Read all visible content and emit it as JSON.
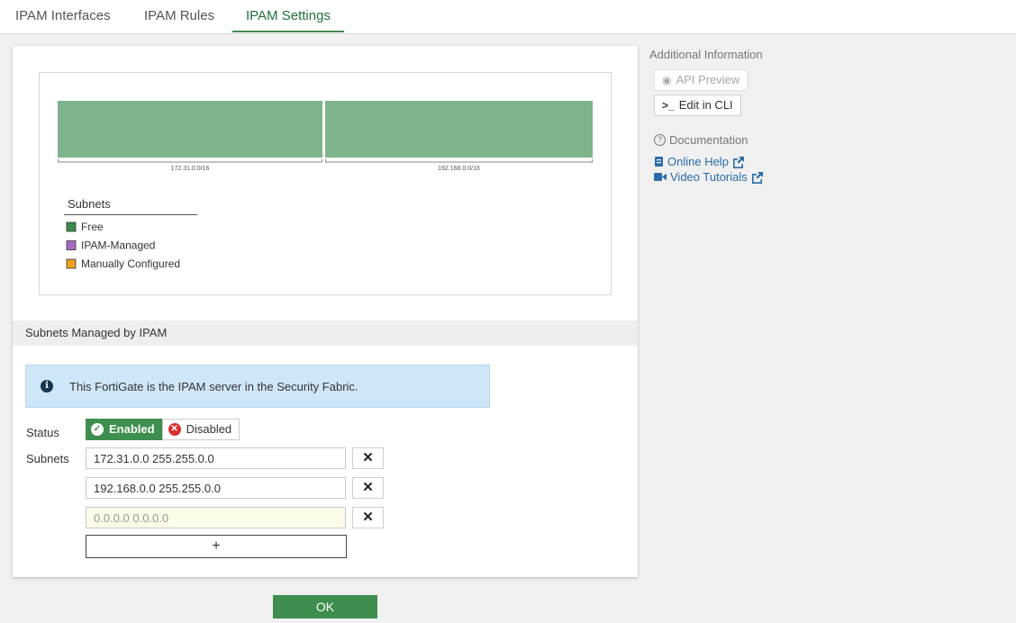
{
  "tabs": [
    {
      "label": "IPAM Interfaces"
    },
    {
      "label": "IPAM Rules"
    },
    {
      "label": "IPAM Settings"
    }
  ],
  "chart_data": {
    "type": "bar",
    "categories": [
      "172.31.0.0/16",
      "192.168.0.0/16"
    ],
    "series": [
      {
        "name": "Free",
        "values": [
          1,
          1
        ]
      },
      {
        "name": "IPAM-Managed",
        "values": [
          0,
          0
        ]
      },
      {
        "name": "Manually Configured",
        "values": [
          0,
          0
        ]
      }
    ],
    "legend_title": "Subnets",
    "legend_position": "bottom-left",
    "colors": {
      "Free": "#7fb38b",
      "IPAM-Managed": "#a46cc2",
      "Manually Configured": "#f0a020"
    },
    "legend_swatch_colors": {
      "Free": "#3d8a4f",
      "IPAM-Managed": "#a46cc2",
      "Manually Configured": "#f0a020"
    }
  },
  "section": {
    "title": "Subnets Managed by IPAM"
  },
  "info_message": "This FortiGate is the IPAM server in the Security Fabric.",
  "form": {
    "status_label": "Status",
    "enabled_label": "Enabled",
    "disabled_label": "Disabled",
    "subnets_label": "Subnets",
    "subnets": [
      "172.31.0.0 255.255.0.0",
      "192.168.0.0 255.255.0.0"
    ],
    "placeholder": "0.0.0.0 0.0.0.0",
    "add_label": "+",
    "remove_label": "✕"
  },
  "ok_label": "OK",
  "sidebar": {
    "title": "Additional Information",
    "api_preview": "API Preview",
    "edit_cli": "Edit in CLI",
    "documentation": "Documentation",
    "online_help": "Online Help",
    "video_tutorials": "Video Tutorials"
  }
}
